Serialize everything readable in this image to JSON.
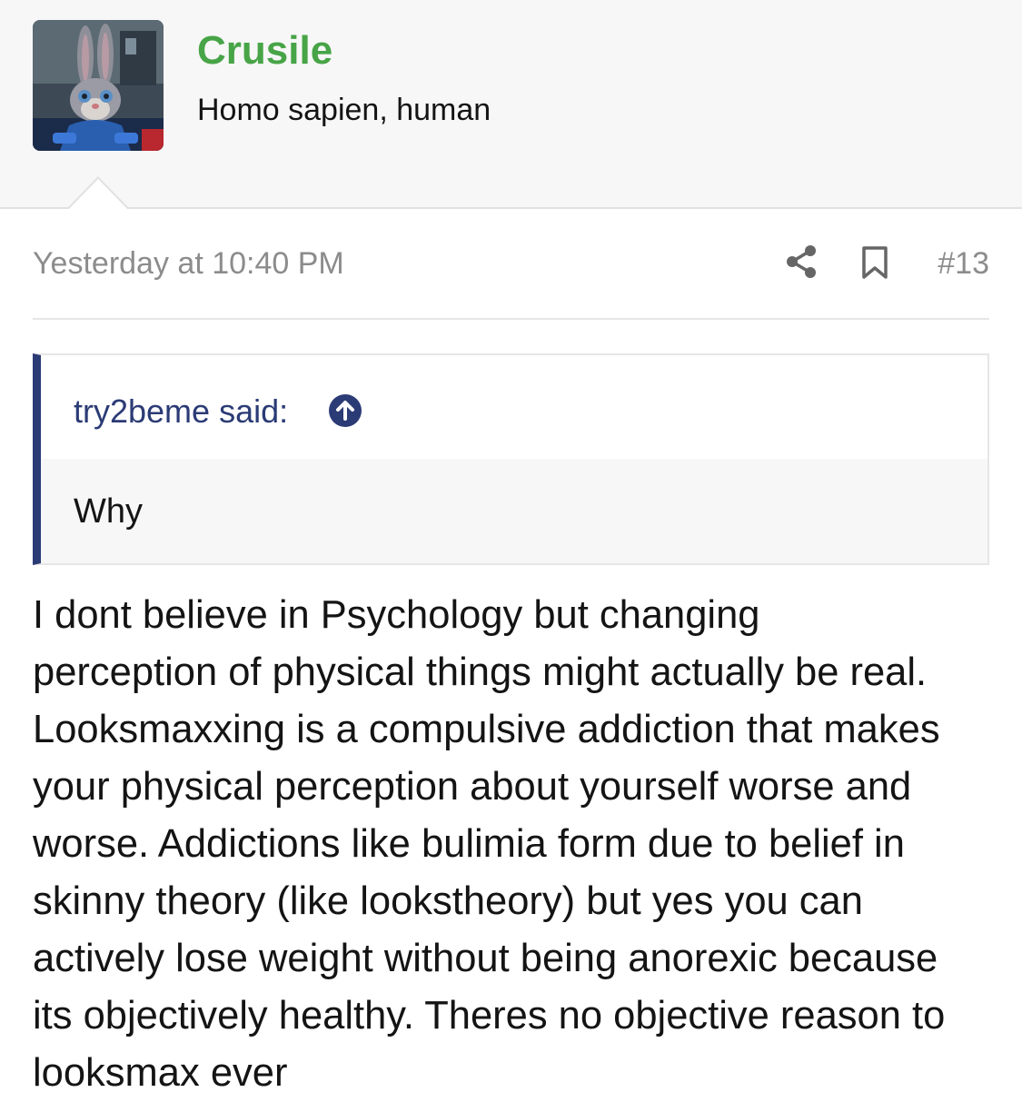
{
  "user": {
    "name": "Crusile",
    "title": "Homo sapien, human"
  },
  "post": {
    "timestamp": "Yesterday at 10:40 PM",
    "number": "#13",
    "body_lines": [
      "I dont believe in Psychology but changing",
      "perception of physical things might actually be real.",
      "Looksmaxxing is a compulsive addiction that makes",
      "your physical perception about yourself worse and",
      "worse. Addictions like bulimia form due to belief in",
      "skinny theory (like lookstheory) but yes you can",
      "actively lose weight without being anorexic because",
      "its objectively healthy. Theres no objective reason to",
      "looksmax ever"
    ]
  },
  "quote": {
    "author_label": "try2beme said:",
    "text": "Why"
  },
  "icons": {
    "share": "share-icon",
    "bookmark": "bookmark-icon",
    "jump_to_quote": "arrow-up-circle-icon"
  },
  "colors": {
    "username": "#47a447",
    "quote_accent": "#2b3b75",
    "meta_text": "#8c8c8c"
  }
}
